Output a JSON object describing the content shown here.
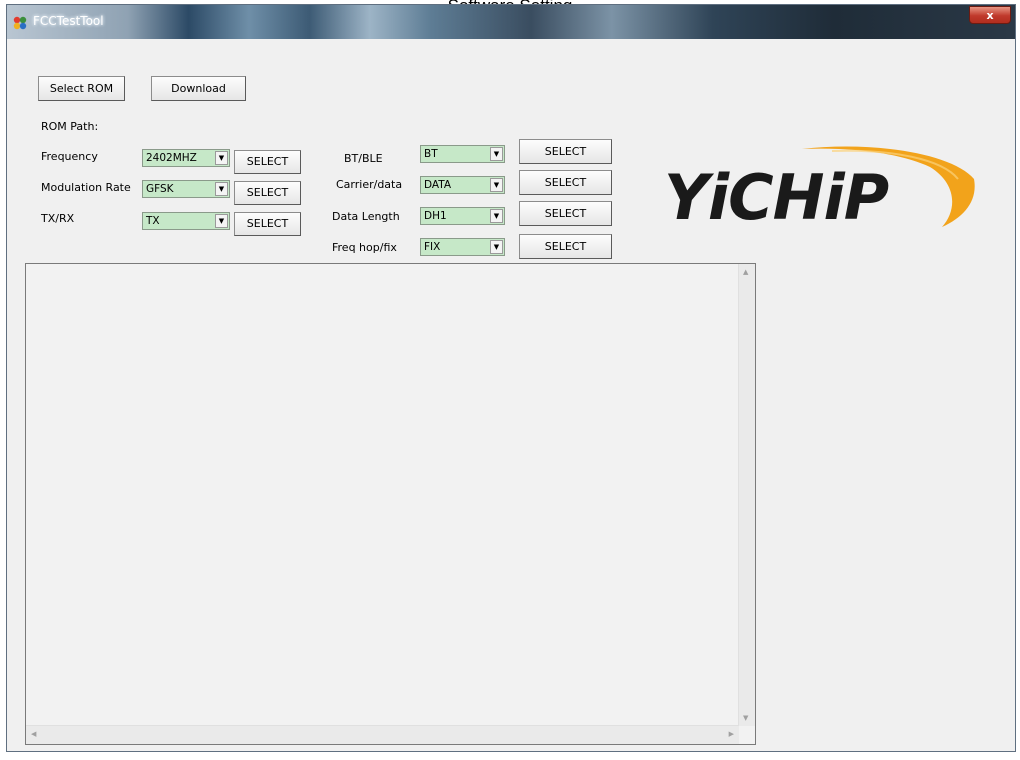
{
  "document": {
    "heading": "Software Setting"
  },
  "window": {
    "title": "FCCTestTool",
    "close_label": "x"
  },
  "toolbar": {
    "select_rom_label": "Select ROM",
    "download_label": "Download",
    "rom_path_label": "ROM Path:"
  },
  "left_settings": [
    {
      "label": "Frequency",
      "value": "2402MHZ",
      "button": "SELECT"
    },
    {
      "label": "Modulation Rate",
      "value": "GFSK",
      "button": "SELECT"
    },
    {
      "label": "TX/RX",
      "value": "TX",
      "button": "SELECT"
    }
  ],
  "right_settings": [
    {
      "label": "BT/BLE",
      "value": "BT",
      "button": "SELECT"
    },
    {
      "label": "Carrier/data",
      "value": "DATA",
      "button": "SELECT"
    },
    {
      "label": "Data Length",
      "value": "DH1",
      "button": "SELECT"
    },
    {
      "label": "Freq hop/fix",
      "value": "FIX",
      "button": "SELECT"
    }
  ],
  "logo": {
    "text": "YiCHiP"
  },
  "log_output": {
    "text": ""
  },
  "colors": {
    "combo_bg": "#c6e8c8",
    "logo_text": "#1a1a1a",
    "logo_swoosh": "#f2a31b"
  }
}
